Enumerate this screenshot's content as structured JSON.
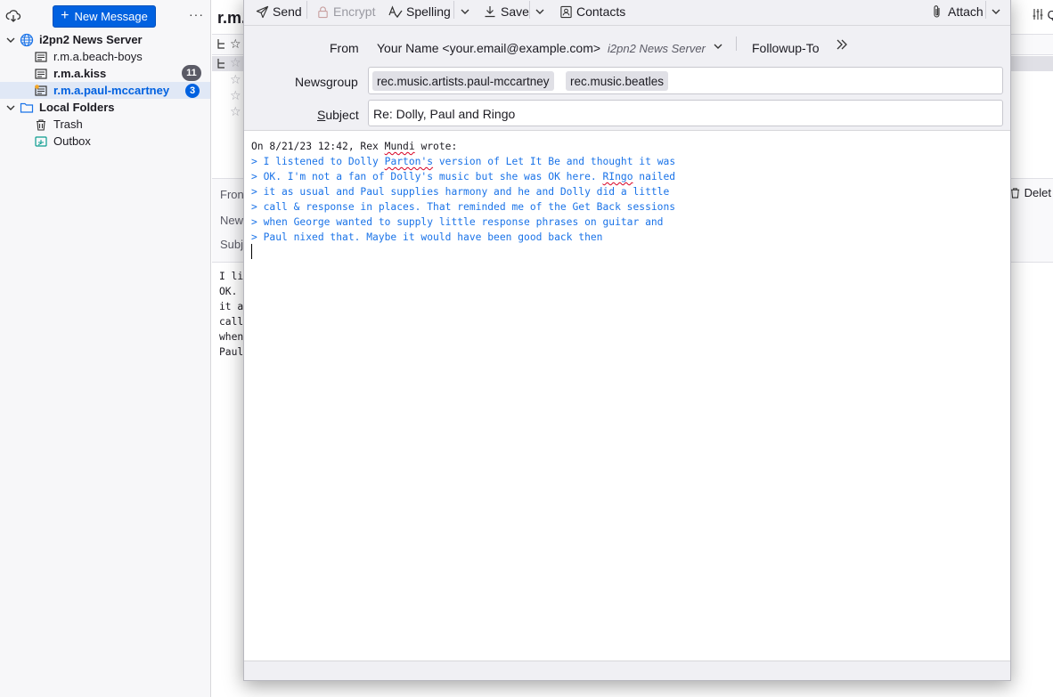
{
  "folder_pane": {
    "new_message": "New Message",
    "more": "···",
    "server": "i2pn2 News Server",
    "groups": [
      {
        "label": "r.m.a.beach-boys",
        "unread": ""
      },
      {
        "label": "r.m.a.kiss",
        "unread": "11"
      },
      {
        "label": "r.m.a.paul-mccartney",
        "unread": "3"
      }
    ],
    "local_folders": "Local Folders",
    "trash": "Trash",
    "outbox": "Outbox"
  },
  "background": {
    "thread_title": "r.m.",
    "labels": [
      "Fron",
      "New",
      "Subj"
    ],
    "body_lines": [
      "I li",
      "OK. ",
      "it a",
      "call",
      "when",
      "Paul"
    ],
    "delete": "Delet",
    "filter": "Q"
  },
  "compose": {
    "toolbar": {
      "send": "Send",
      "encrypt": "Encrypt",
      "spelling": "Spelling",
      "save": "Save",
      "contacts": "Contacts",
      "attach": "Attach"
    },
    "from_label": "From",
    "from_value": "Your Name <your.email@example.com>",
    "from_account": "i2pn2 News Server",
    "followup": "Followup-To",
    "newsgroup_label": "Newsgroup",
    "newsgroups": [
      "rec.music.artists.paul-mccartney",
      "rec.music.beatles"
    ],
    "subject_label": "Subject",
    "subject_value": "Re: Dolly, Paul and Ringo",
    "body": {
      "attribution_pre": "On 8/21/23 12:42, Rex ",
      "attribution_name": "Mundi",
      "attribution_post": " wrote:",
      "q1_pre": "> I listened to Dolly ",
      "q1_word": "Parton's",
      "q1_post": " version of Let It Be and thought it was",
      "q2_pre": "> OK. I'm not a fan of Dolly's music but she was OK here. ",
      "q2_word": "RIngo",
      "q2_post": " nailed",
      "q3": "> it as usual and Paul supplies harmony and he and Dolly did a little",
      "q4": "> call & response in places. That reminded me of the Get Back sessions",
      "q5": "> when George wanted to supply little response phrases on guitar and",
      "q6": "> Paul nixed that. Maybe it would have been good back then"
    }
  }
}
